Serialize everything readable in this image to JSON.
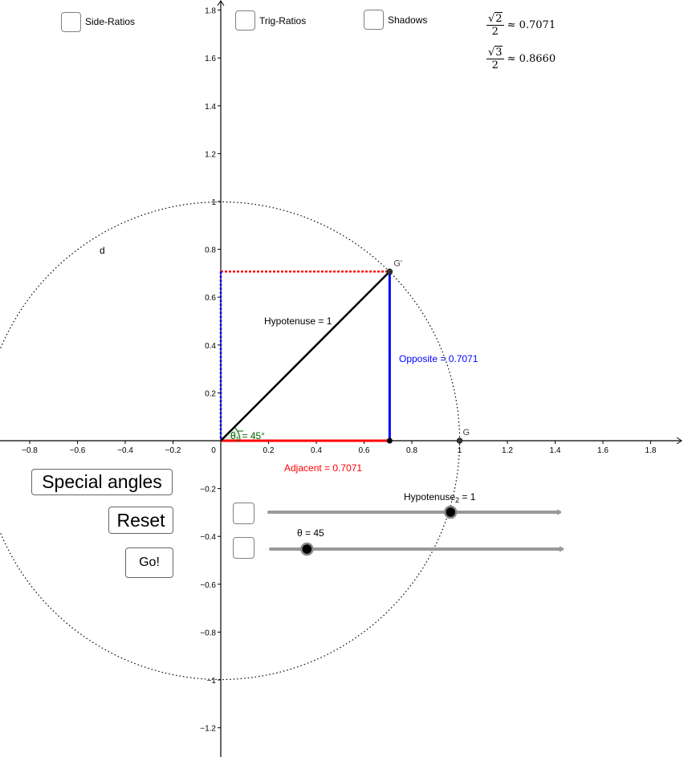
{
  "checkboxes": {
    "side_ratios": "Side-Ratios",
    "trig_ratios": "Trig-Ratios",
    "shadows": "Shadows"
  },
  "formulas": [
    {
      "radicand": "2",
      "denominator": "2",
      "approx": "≈ 0.7071"
    },
    {
      "radicand": "3",
      "denominator": "2",
      "approx": "≈ 0.8660"
    }
  ],
  "buttons": {
    "special_angles": "Special angles",
    "reset": "Reset",
    "go": "Go!"
  },
  "sliders": [
    {
      "label": "Hypotenuse",
      "subscript": "2",
      "value_text": " = 1",
      "value": 1,
      "min": -1.5,
      "max": 2.5
    },
    {
      "label": "θ",
      "subscript": "",
      "value_text": " = 45",
      "value": 45,
      "min": 0,
      "max": 360
    }
  ],
  "graph": {
    "x_ticks": [
      "−0.8",
      "−0.6",
      "−0.4",
      "−0.2",
      "0",
      "0.2",
      "0.4",
      "0.6",
      "0.8",
      "1",
      "1.2",
      "1.4",
      "1.6",
      "1.8"
    ],
    "x_tick_values": [
      -0.8,
      -0.6,
      -0.4,
      -0.2,
      0,
      0.2,
      0.4,
      0.6,
      0.8,
      1,
      1.2,
      1.4,
      1.6,
      1.8
    ],
    "y_ticks": [
      "1.8",
      "1.6",
      "1.4",
      "1.2",
      "1",
      "0.8",
      "0.6",
      "0.4",
      "0.2",
      "−0.2",
      "−0.4",
      "−0.6",
      "−0.8",
      "−1",
      "−1.2"
    ],
    "y_tick_values": [
      1.8,
      1.6,
      1.4,
      1.2,
      1,
      0.8,
      0.6,
      0.4,
      0.2,
      -0.2,
      -0.4,
      -0.6,
      -0.8,
      -1,
      -1.2
    ],
    "circle_label": "d",
    "point_g": "G",
    "point_g_prime": "G'",
    "point_g_coords": [
      1,
      0
    ],
    "point_g_prime_coords": [
      0.7071,
      0.7071
    ],
    "hypotenuse_label": "Hypotenuse = 1",
    "opposite_label": "Opposite = 0.7071",
    "adjacent_label": "Adjacent = 0.7071",
    "angle_label": "θ",
    "angle_subscript": "1",
    "angle_value": " = 45°",
    "colors": {
      "hypotenuse": "#000000",
      "opposite": "#0000ff",
      "adjacent": "#ff0000",
      "angle": "#006400",
      "slider_track": "#999999"
    }
  }
}
